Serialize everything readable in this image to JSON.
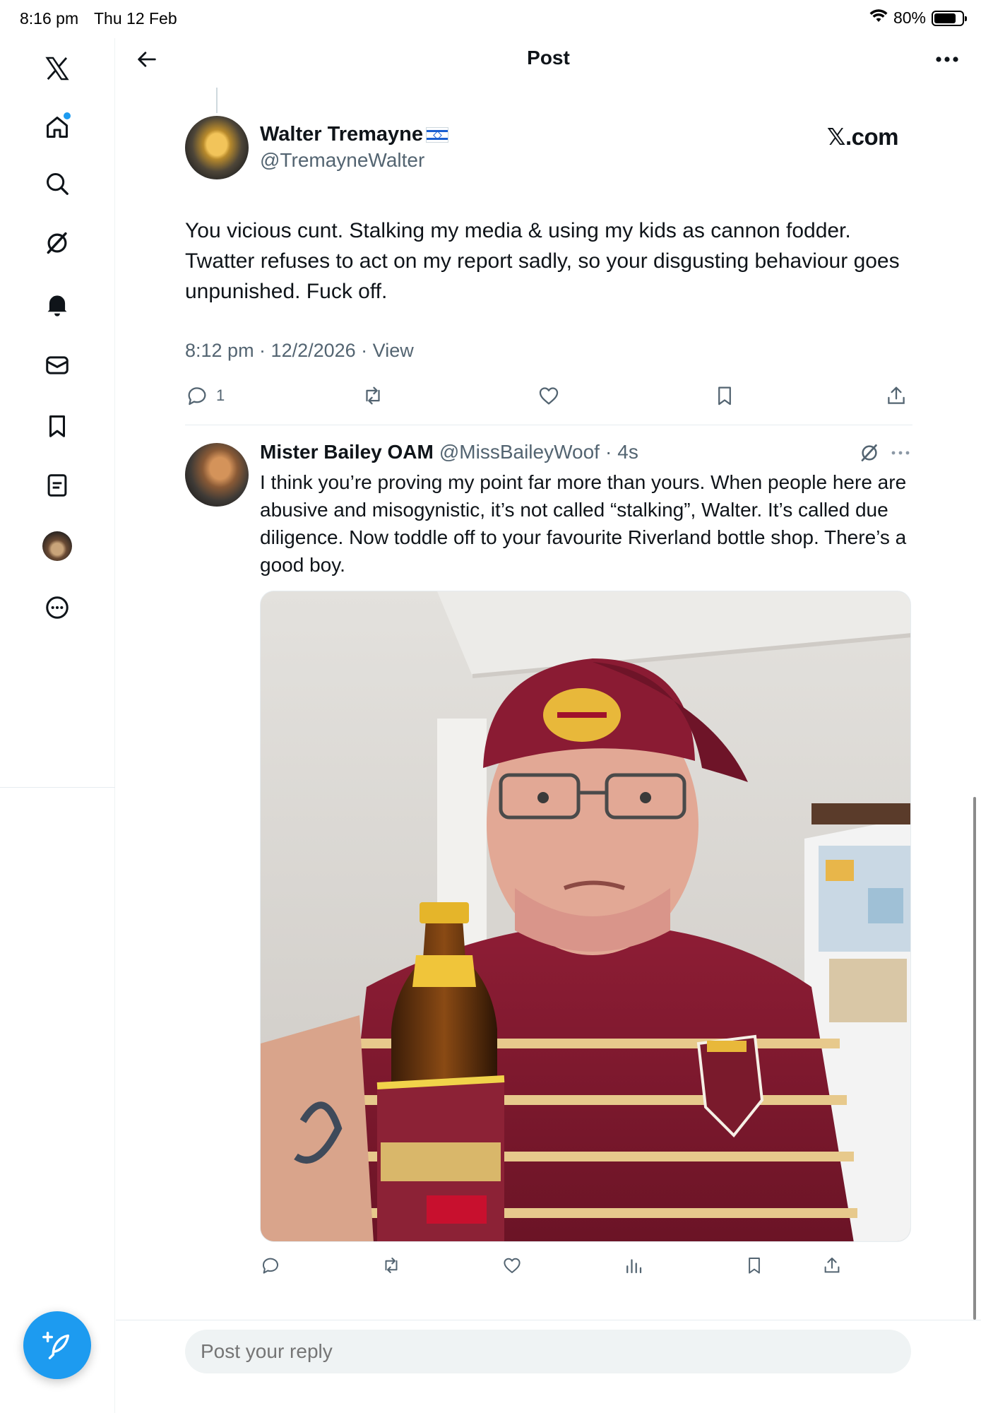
{
  "status_bar": {
    "time": "8:16 pm",
    "date": "Thu 12 Feb",
    "battery": "80%",
    "battery_level": 0.8
  },
  "sidebar": {
    "items": [
      {
        "name": "x-logo-icon"
      },
      {
        "name": "home-icon",
        "has_notification": true
      },
      {
        "name": "search-icon"
      },
      {
        "name": "grok-icon"
      },
      {
        "name": "bell-icon"
      },
      {
        "name": "mail-icon"
      },
      {
        "name": "bookmark-icon"
      },
      {
        "name": "lists-icon"
      },
      {
        "name": "profile-avatar"
      },
      {
        "name": "more-circle-icon"
      }
    ],
    "compose_icon": "compose-post-icon",
    "accent_color": "#1d9bf0"
  },
  "header": {
    "title": "Post",
    "back_icon": "arrow-left-icon",
    "more_icon": "more-horizontal-icon"
  },
  "main_post": {
    "author_name": "Walter Tremayne",
    "author_flag": "israel-flag-icon",
    "author_handle": "@TremayneWalter",
    "badge": "𝕏.com",
    "text": "You vicious cunt. Stalking my media & using my kids as cannon fodder. Twatter refuses to act on my report sadly, so your disgusting behaviour goes unpunished. Fuck off.",
    "timestamp": "8:12 pm · 12/2/2026 · ",
    "view_label": "View",
    "reply_count": "1",
    "actions": [
      "reply",
      "repost",
      "like",
      "bookmark",
      "share"
    ]
  },
  "reply_post": {
    "author_name": "Mister Bailey OAM",
    "author_handle": "@MissBaileyWoof",
    "separator": "·",
    "time": "4s",
    "text": "I think you’re proving my point far more than yours. When people here are abusive and misogynistic, it’s not called “stalking”, Walter. It’s called due diligence. Now toddle off to your favourite Riverland bottle shop. There’s a good boy.",
    "media_description_icon": "photo-icon",
    "actions": [
      "reply",
      "repost",
      "like",
      "views",
      "bookmark",
      "share"
    ]
  },
  "reply_bar": {
    "placeholder": "Post your reply"
  }
}
